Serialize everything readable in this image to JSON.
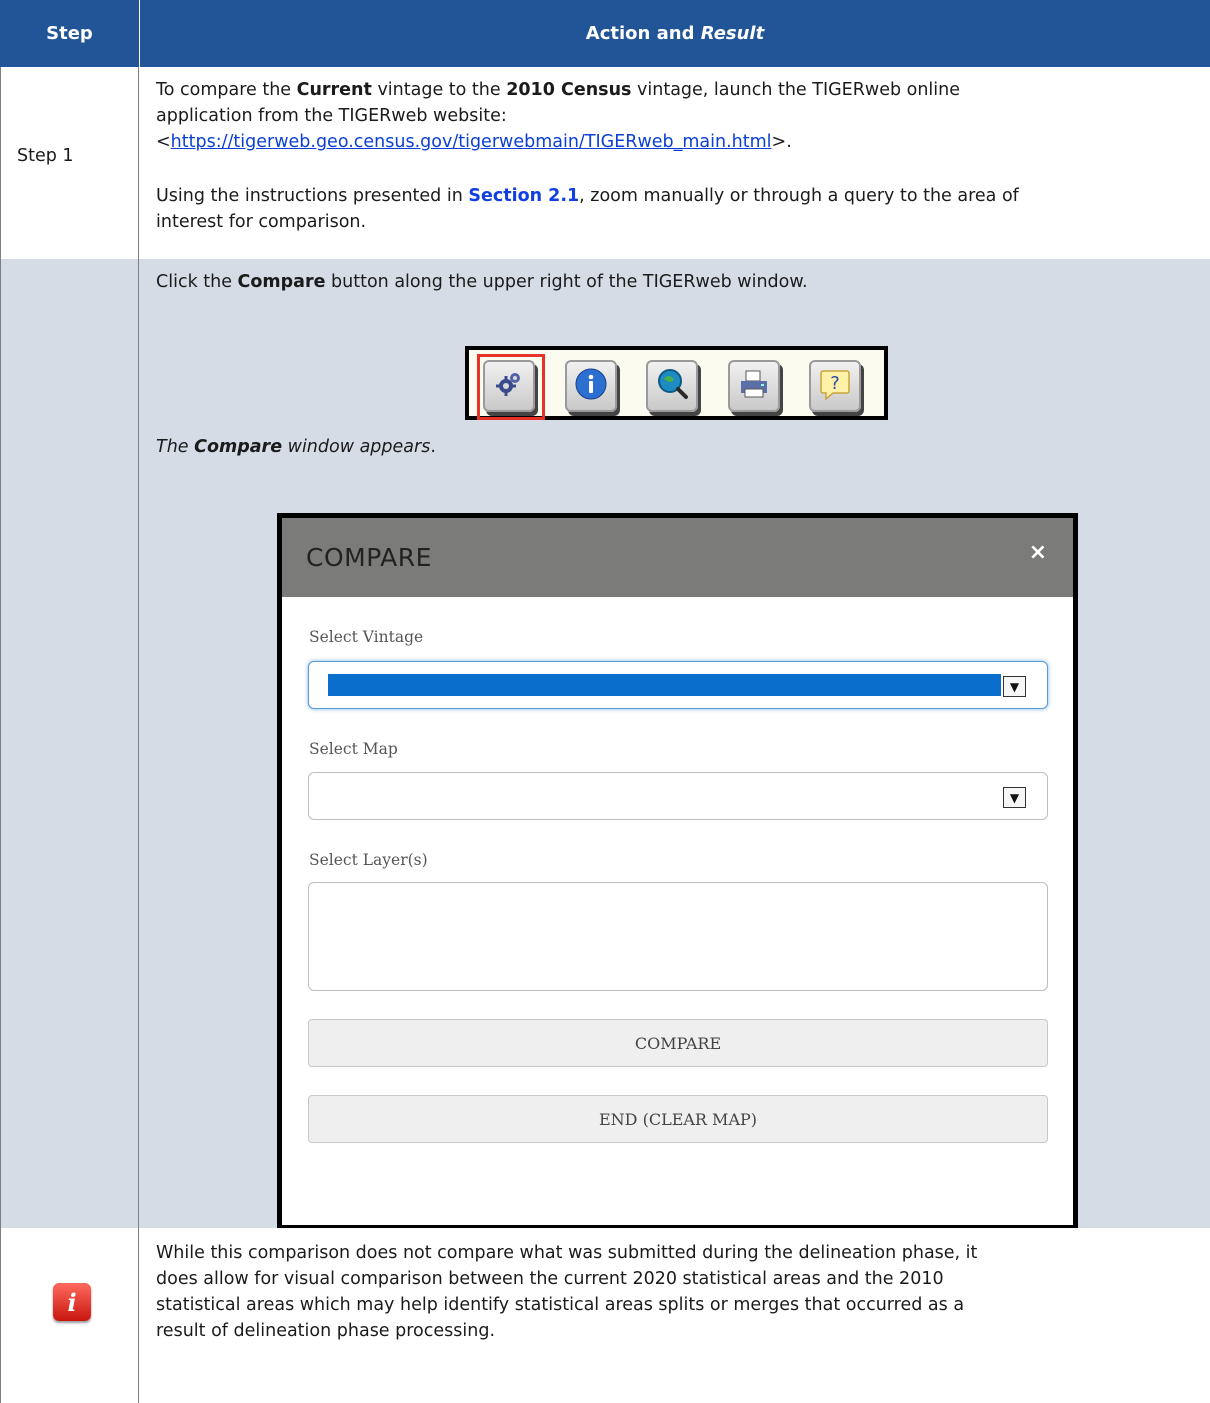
{
  "header": {
    "step_col": "Step",
    "action_col_plain": "Action and ",
    "action_col_italic": "Result"
  },
  "row1": {
    "step": "Step 1",
    "p1_a": "To compare the ",
    "p1_b": "Current",
    "p1_c": " vintage to the ",
    "p1_d": "2010 Census",
    "p1_e": " vintage, launch the TIGERweb online",
    "p1_line2": "application from the TIGERweb website:",
    "p1_lt": "<",
    "p1_link": "https://tigerweb.geo.census.gov/tigerwebmain/TIGERweb_main.html",
    "p1_gt": ">.",
    "p2_a": "Using the instructions presented in ",
    "p2_section": "Section 2.1",
    "p2_b": ", zoom manually or through a query to the area of",
    "p2_line2": "interest for comparison."
  },
  "row2": {
    "instr_a": "Click the ",
    "instr_b": "Compare",
    "instr_c": " button along the upper right of the TIGERweb window.",
    "result_a": "The ",
    "result_b": "Compare",
    "result_c": " window appears",
    "result_d": ".",
    "toolbar_icons": [
      "gear-icon",
      "info-icon",
      "search-icon",
      "print-icon",
      "help-icon"
    ],
    "dialog": {
      "title": "COMPARE",
      "close": "×",
      "vintage_label": "Select Vintage",
      "map_label": "Select Map",
      "layers_label": "Select Layer(s)",
      "compare_button": "COMPARE",
      "end_button": "END (CLEAR MAP)"
    }
  },
  "row3": {
    "line1": "While this comparison does not compare what was submitted during the delineation phase, it",
    "line2": "does allow for visual comparison between the current 2020 statistical areas and the 2010",
    "line3": "statistical areas which may help identify statistical areas splits or merges that occurred as a",
    "line4": "result of delineation phase processing.",
    "icon_glyph": "i"
  },
  "colors": {
    "header_bg": "#215597",
    "shaded_row": "#d6dce5",
    "link": "#0b3fd6",
    "highlight": "#e63228"
  }
}
